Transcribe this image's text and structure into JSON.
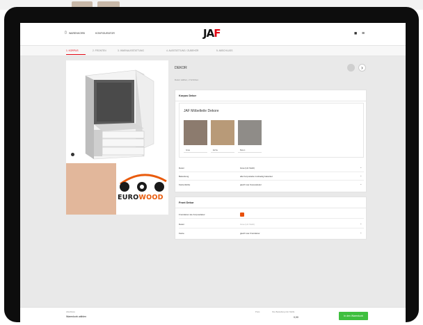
{
  "header": {
    "left_link_1": "WARENKORB",
    "left_link_2": "KONFIGURATOR",
    "logo_left": "JA",
    "logo_accent": "F",
    "cart_icon": "cart-icon",
    "menu_icon": "menu-icon"
  },
  "steps": [
    {
      "label": "1. KORPUS"
    },
    {
      "label": "2. FRONTEN"
    },
    {
      "label": "3. INNENAUSSTATTUNG"
    },
    {
      "label": "4. AUSSTATTUNG / ZUBEHÖR"
    },
    {
      "label": "5. ABSCHLUSS"
    }
  ],
  "content": {
    "title": "DEKOR",
    "subtitle": "Dekor wählen, 2 Schritten",
    "next_symbol": "›"
  },
  "korpus_panel": {
    "title": "Korpus Dekor",
    "subcard_title": "JAF Möbelteile Dekore",
    "swatches": [
      {
        "label": "Grau",
        "color": "#8c7b6e"
      },
      {
        "label": "Eiche",
        "color": "#b89a78"
      },
      {
        "label": "Beton",
        "color": "#8f8c88"
      }
    ],
    "rows": [
      {
        "label": "Dekor",
        "value": "Grau (H1 Stahl)"
      },
      {
        "label": "Bekantung",
        "value": "alle Korpusteile rundseitig bekantet"
      },
      {
        "label": "Kantenfarbe",
        "value": "gleich wie Korpusdekor"
      }
    ]
  },
  "front_panel": {
    "title": "Front Dekor",
    "rows": [
      {
        "label": "Frontdekor wie Korpusdekor",
        "value": ""
      },
      {
        "label": "Dekor",
        "value": "Grau (H1 Stahl)"
      },
      {
        "label": "Kante",
        "value": "gleich wie Frontdekor"
      }
    ]
  },
  "brand": {
    "word_start": "EURO",
    "word_accent": "WOOD"
  },
  "footer": {
    "label": "Abschluss",
    "value": "Warenkorb wählen",
    "small_1": "Preis",
    "small_2": "Ihre Bestellung inkl. MwSt.",
    "price": "0,00",
    "cta": "In den Warenkorb"
  },
  "colors": {
    "accent": "#e30613",
    "cta": "#3fbf3f",
    "checkbox": "#e8500b",
    "brand_swatch": "#e2b79b"
  }
}
